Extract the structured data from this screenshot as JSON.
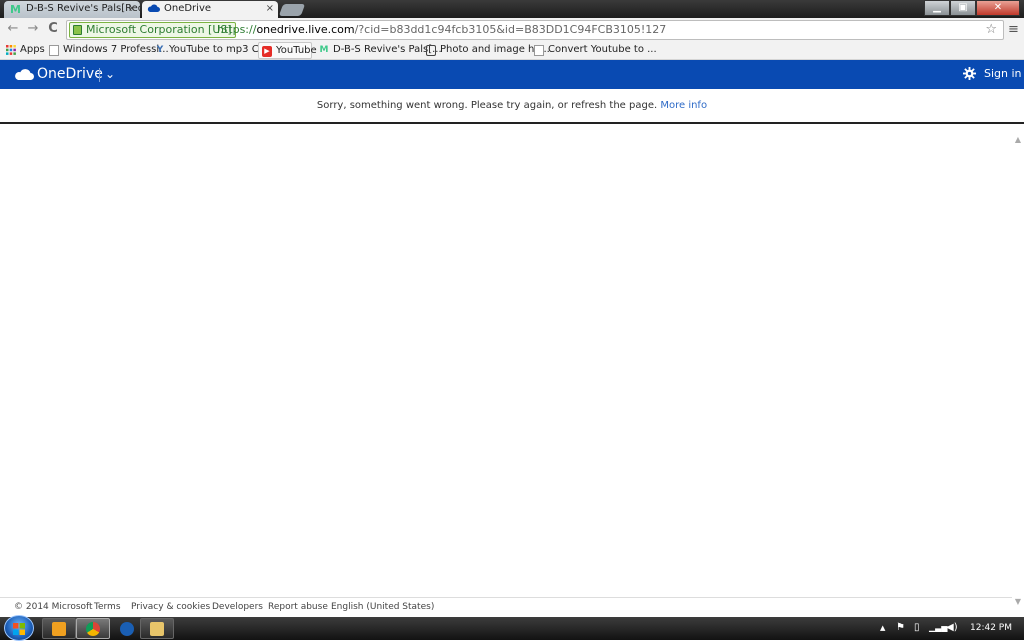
{
  "browser": {
    "tabs": [
      {
        "label": "D-B-S Revive's Pals[Reque",
        "favicon": "M"
      },
      {
        "label": "OneDrive",
        "favicon": "cloud-icon"
      }
    ],
    "tab_close": "×",
    "ev_label": "Microsoft Corporation [US]",
    "url_scheme": "https://",
    "url_host": "onedrive.live.com",
    "url_rest": "/?cid=b83dd1c94fcb3105&id=B83DD1C94FCB3105!127",
    "star": "☆",
    "menu": "≡",
    "back": "←",
    "forward": "→",
    "reload": "C",
    "window_buttons": {
      "minimize": "▁",
      "maximize": "▣",
      "close": "✕"
    }
  },
  "bookmarks": [
    {
      "label": "Apps",
      "icon": "apps-grid-icon"
    },
    {
      "label": "Windows 7 Professi...",
      "icon": "page-icon"
    },
    {
      "label": "YouTube to mp3 Co...",
      "icon": "yt-mp3-icon"
    },
    {
      "label": "YouTube",
      "icon": "youtube-icon"
    },
    {
      "label": "D-B-S Revive's Pals[...",
      "icon": "m-icon"
    },
    {
      "label": "Photo and image ho...",
      "icon": "camera-icon"
    },
    {
      "label": "Convert Youtube to ...",
      "icon": "page-icon"
    }
  ],
  "onedrive": {
    "brand": "OneDrive",
    "chevron": "⌄",
    "sign_in": "Sign in",
    "notice": "Sorry, something went wrong. Please try again, or refresh the page.",
    "more_info": "More info"
  },
  "footer": {
    "copyright": "© 2014 Microsoft",
    "terms": "Terms",
    "privacy": "Privacy & cookies",
    "developers": "Developers",
    "report_abuse": "Report abuse",
    "language": "English (United States)"
  },
  "taskbar": {
    "clock": "12:42 PM",
    "tray_arrow": "▲",
    "colors": {
      "brand_blue": "#094ab2",
      "link_blue": "#2f6bc7"
    }
  }
}
